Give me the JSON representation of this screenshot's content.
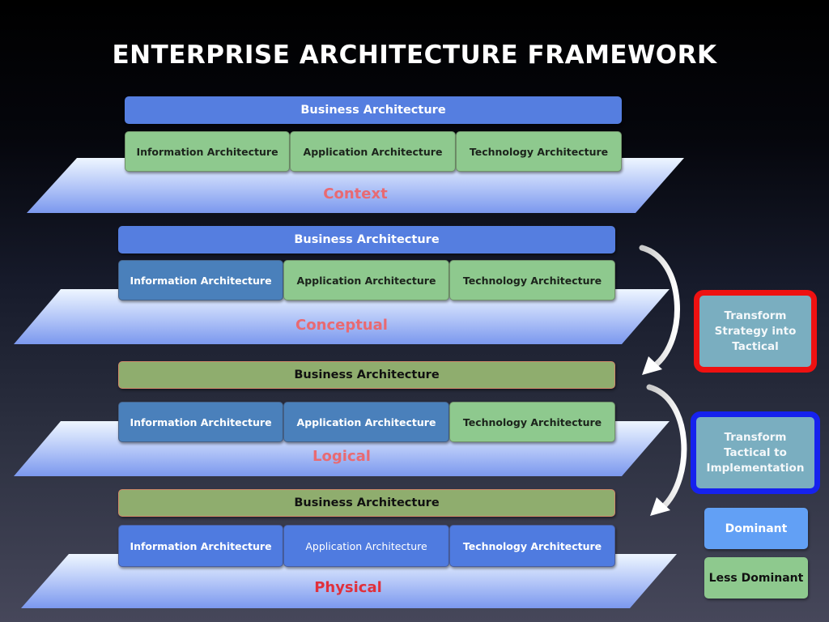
{
  "title": "ENTERPRISE ARCHITECTURE FRAMEWORK",
  "layers": [
    {
      "name": "Context",
      "business": {
        "label": "Business Architecture",
        "dominance": "dominant"
      },
      "components": [
        {
          "label": "Information Architecture",
          "dominance": "less-dominant"
        },
        {
          "label": "Application Architecture",
          "dominance": "less-dominant"
        },
        {
          "label": "Technology Architecture",
          "dominance": "less-dominant"
        }
      ]
    },
    {
      "name": "Conceptual",
      "business": {
        "label": "Business Architecture",
        "dominance": "dominant"
      },
      "components": [
        {
          "label": "Information Architecture",
          "dominance": "dominant"
        },
        {
          "label": "Application Architecture",
          "dominance": "less-dominant"
        },
        {
          "label": "Technology Architecture",
          "dominance": "less-dominant"
        }
      ]
    },
    {
      "name": "Logical",
      "business": {
        "label": "Business Architecture",
        "dominance": "less-dominant"
      },
      "components": [
        {
          "label": "Information Architecture",
          "dominance": "dominant"
        },
        {
          "label": "Application Architecture",
          "dominance": "dominant"
        },
        {
          "label": "Technology Architecture",
          "dominance": "less-dominant"
        }
      ]
    },
    {
      "name": "Physical",
      "business": {
        "label": "Business Architecture",
        "dominance": "less-dominant"
      },
      "components": [
        {
          "label": "Information Architecture",
          "dominance": "dominant"
        },
        {
          "label": "Application Architecture",
          "dominance": "dominant"
        },
        {
          "label": "Technology Architecture",
          "dominance": "dominant"
        }
      ]
    }
  ],
  "transforms": [
    {
      "label": "Transform Strategy into Tactical",
      "from": "Conceptual",
      "to": "Logical",
      "border_color": "#ee1111"
    },
    {
      "label": "Transform Tactical to Implementation",
      "from": "Logical",
      "to": "Physical",
      "border_color": "#1622ee"
    }
  ],
  "legend": {
    "dominant": {
      "label": "Dominant",
      "color": "#62a0f5"
    },
    "less_dominant": {
      "label": "Less Dominant",
      "color": "#8ec98e"
    }
  },
  "colors": {
    "dominant_bar": "#557ee0",
    "less_dominant_bar": "#8fad6e",
    "plane_label": "#e86a72"
  }
}
